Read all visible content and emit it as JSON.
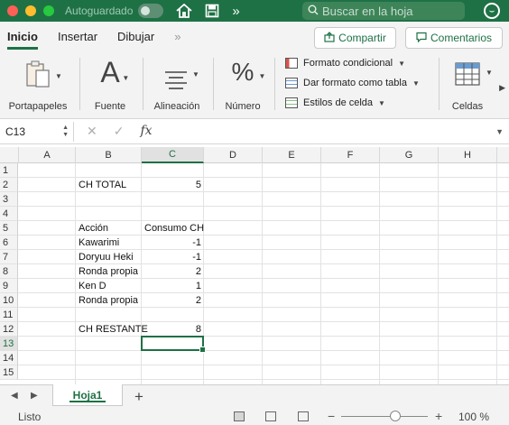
{
  "titlebar": {
    "autosave_label": "Autoguardado",
    "search_placeholder": "Buscar en la hoja"
  },
  "ribbon_tabs": [
    "Inicio",
    "Insertar",
    "Dibujar"
  ],
  "ribbon_actions": {
    "share": "Compartir",
    "comments": "Comentarios"
  },
  "ribbon_groups": {
    "clipboard": "Portapapeles",
    "font": "Fuente",
    "alignment": "Alineación",
    "number": "Número",
    "cells": "Celdas",
    "conditional_format": "Formato condicional",
    "format_as_table": "Dar formato como tabla",
    "cell_styles": "Estilos de celda"
  },
  "formula_bar": {
    "name_box": "C13",
    "formula": ""
  },
  "grid": {
    "columns": [
      "A",
      "B",
      "C",
      "D",
      "E",
      "F",
      "G",
      "H"
    ],
    "rows": [
      "1",
      "2",
      "3",
      "4",
      "5",
      "6",
      "7",
      "8",
      "9",
      "10",
      "11",
      "12",
      "13",
      "14",
      "15"
    ],
    "selected_cell": "C13",
    "cells": {
      "B2": "CH TOTAL",
      "C2": "5",
      "B5": "Acción",
      "C5": "Consumo CH",
      "B6": "Kawarimi",
      "C6": "-1",
      "B7": "Doryuu Heki",
      "C7": "-1",
      "B8": "Ronda propia",
      "C8": "2",
      "B9": "Ken D",
      "C9": "1",
      "B10": "Ronda propia",
      "C10": "2",
      "B12": "CH RESTANTE",
      "C12": "8"
    }
  },
  "sheet_tabs": [
    "Hoja1"
  ],
  "status": {
    "ready": "Listo",
    "zoom": "100 %",
    "zoom_level_percent": 100
  },
  "colors": {
    "accent": "#1e7145"
  }
}
